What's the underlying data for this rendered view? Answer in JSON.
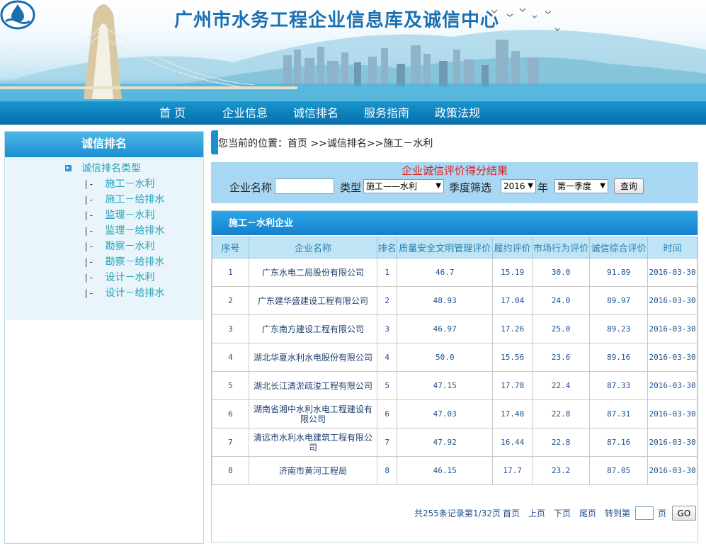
{
  "site_title": "广州市水务工程企业信息库及诚信中心",
  "nav": [
    {
      "label": "首 页"
    },
    {
      "label": "企业信息"
    },
    {
      "label": "诚信排名"
    },
    {
      "label": "服务指南"
    },
    {
      "label": "政策法规"
    }
  ],
  "sidebar": {
    "title": "诚信排名",
    "category_label": "诚信排名类型",
    "tree_mark": "|-",
    "items": [
      {
        "label": "施工－水利"
      },
      {
        "label": "施工－给排水"
      },
      {
        "label": "监理－水利"
      },
      {
        "label": "监理－给排水"
      },
      {
        "label": "勘察－水利"
      },
      {
        "label": "勘察－给排水"
      },
      {
        "label": "设计－水利"
      },
      {
        "label": "设计－给排水"
      }
    ]
  },
  "breadcrumb": "您当前的位置：首页 >>诚信排名>>施工－水利",
  "search": {
    "title": "企业诚信评价得分结果",
    "company_label": "企业名称",
    "company_value": "",
    "type_label": "类型",
    "type_value": "施工——水利",
    "season_label": "季度筛选",
    "year_value": "2016",
    "year_suffix": "年",
    "quarter_value": "第一季度",
    "query_button": "查询"
  },
  "results": {
    "title": "施工－水利企业",
    "columns": [
      "序号",
      "企业名称",
      "排名",
      "质量安全文明管理评价",
      "履约评价",
      "市场行为评价",
      "诚信综合评价",
      "时间"
    ],
    "rows": [
      [
        "1",
        "广东水电二局股份有限公司",
        "1",
        "46.7",
        "15.19",
        "30.0",
        "91.89",
        "2016-03-30"
      ],
      [
        "2",
        "广东建华盛建设工程有限公司",
        "2",
        "48.93",
        "17.04",
        "24.0",
        "89.97",
        "2016-03-30"
      ],
      [
        "3",
        "广东南方建设工程有限公司",
        "3",
        "46.97",
        "17.26",
        "25.0",
        "89.23",
        "2016-03-30"
      ],
      [
        "4",
        "湖北华夏水利水电股份有限公司",
        "4",
        "50.0",
        "15.56",
        "23.6",
        "89.16",
        "2016-03-30"
      ],
      [
        "5",
        "湖北长江清淤疏浚工程有限公司",
        "5",
        "47.15",
        "17.78",
        "22.4",
        "87.33",
        "2016-03-30"
      ],
      [
        "6",
        "湖南省湘中水利水电工程建设有限公司",
        "6",
        "47.03",
        "17.48",
        "22.8",
        "87.31",
        "2016-03-30"
      ],
      [
        "7",
        "清远市水利水电建筑工程有限公司",
        "7",
        "47.92",
        "16.44",
        "22.8",
        "87.16",
        "2016-03-30"
      ],
      [
        "8",
        "济南市黄河工程局",
        "8",
        "46.15",
        "17.7",
        "23.2",
        "87.05",
        "2016-03-30"
      ]
    ]
  },
  "pager": {
    "total": "共255条记录",
    "page": "第1/32页",
    "first": "首页",
    "prev": "上页",
    "next": "下页",
    "last": "尾页",
    "goto_label": "转到第",
    "goto_value": "",
    "page_suffix": "页",
    "go_button": "GO"
  },
  "colors": {
    "nav_blue": "#0d7fbb",
    "link_teal": "#23a3b8",
    "title_red": "#e02020",
    "search_panel": "#a7d7f2"
  }
}
